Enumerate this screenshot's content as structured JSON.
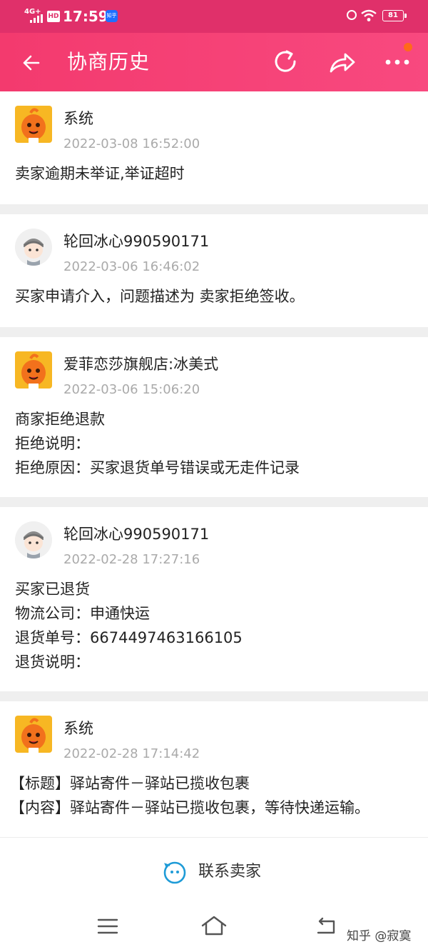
{
  "status_bar": {
    "network": "4G+",
    "hd": "HD",
    "time": "17:59",
    "app_badge": "知乎",
    "battery": "81"
  },
  "nav": {
    "title": "协商历史",
    "back_icon": "back-arrow-icon",
    "refresh_icon": "refresh-icon",
    "share_icon": "share-icon",
    "more_icon": "more-icon"
  },
  "entries": [
    {
      "name": "系统",
      "time": "2022-03-08 16:52:00",
      "avatar": "system-mascot-avatar",
      "lines": [
        "卖家逾期未举证,举证超时"
      ]
    },
    {
      "name": "轮回冰心990590171",
      "time": "2022-03-06 16:46:02",
      "avatar": "user-avatar",
      "lines": [
        "买家申请介入，问题描述为  卖家拒绝签收。"
      ]
    },
    {
      "name": "爱菲恋莎旗舰店:冰美式",
      "time": "2022-03-06 15:06:20",
      "avatar": "shop-mascot-avatar",
      "lines": [
        "商家拒绝退款",
        "拒绝说明：",
        "拒绝原因：买家退货单号错误或无走件记录"
      ]
    },
    {
      "name": "轮回冰心990590171",
      "time": "2022-02-28 17:27:16",
      "avatar": "user-avatar",
      "lines": [
        "买家已退货",
        "物流公司：申通快运",
        "退货单号：6674497463166105",
        "退货说明："
      ]
    },
    {
      "name": "系统",
      "time": "2022-02-28 17:14:42",
      "avatar": "system-mascot-avatar",
      "lines": [
        "【标题】驿站寄件－驿站已揽收包裹",
        "【内容】驿站寄件－驿站已揽收包裹，等待快递运输。"
      ]
    }
  ],
  "contact": {
    "label": "联系卖家",
    "icon": "chat-bubble-icon"
  },
  "system_nav": {
    "menu_icon": "menu-icon",
    "home_icon": "home-icon",
    "back_icon": "back-icon",
    "watermark": "知乎 @寂寞"
  },
  "colors": {
    "accent": "#f33a6e",
    "status_bar": "#e0306a",
    "time_text": "#aaaaaa",
    "divider": "#efefef"
  }
}
